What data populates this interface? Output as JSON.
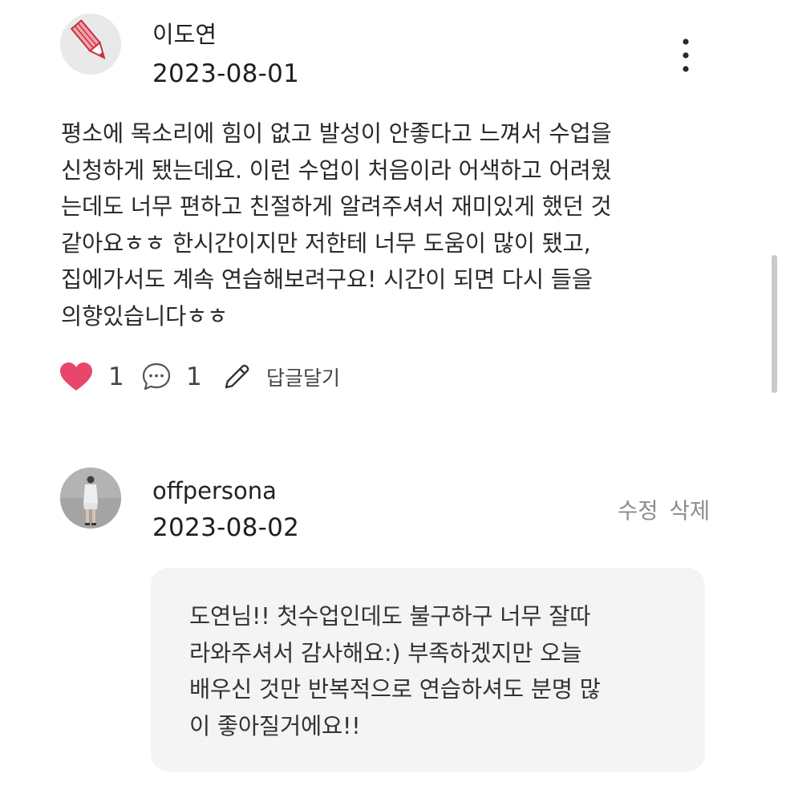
{
  "review": {
    "author": "이도연",
    "date": "2023-08-01",
    "body_lines": [
      "평소에 목소리에 힘이 없고 발성이 안좋다고 느껴서 수업을",
      "신청하게 됐는데요. 이런 수업이 처음이라 어색하고 어려웠",
      "는데도 너무 편하고 친절하게 알려주셔서 재미있게 했던 것",
      "같아요ㅎㅎ 한시간이지만 저한테 너무 도움이 많이 됐고,",
      "집에가서도 계속 연습해보려구요! 시간이 되면 다시 들을",
      "의향있습니다ㅎㅎ"
    ],
    "like_count": "1",
    "comment_count": "1",
    "write_reply_label": "답글달기"
  },
  "reply": {
    "author": "offpersona",
    "date": "2023-08-02",
    "edit_label": "수정",
    "delete_label": "삭제",
    "text_lines": [
      "도연님!! 첫수업인데도 불구하구 너무 잘따",
      "라와주셔서 감사해요:) 부족하겠지만 오늘",
      "배우신 것만 반복적으로 연습하셔도 분명 많",
      "이 좋아질거에요!!"
    ]
  },
  "icons": {
    "review_avatar": "pencil-icon",
    "reply_avatar": "profile-photo",
    "menu": "more-vertical-icon",
    "like": "heart-icon",
    "comment": "speech-bubble-icon",
    "write": "pencil-outline-icon"
  },
  "colors": {
    "heart": "#e8476b",
    "pencil_pink": "#f0a0a8",
    "muted_text": "#8c8c8c",
    "bubble_bg": "#f4f4f4"
  }
}
